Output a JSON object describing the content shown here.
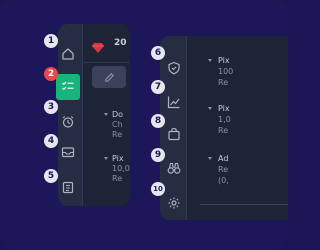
{
  "header": {
    "gem_value": "20"
  },
  "badges": [
    "1",
    "2",
    "3",
    "4",
    "5",
    "6",
    "7",
    "8",
    "9",
    "10"
  ],
  "left_list": [
    {
      "lines": [
        "Do",
        "Ch",
        "Re"
      ]
    },
    {
      "lines": [
        "Pix",
        "10,0",
        "Re"
      ]
    }
  ],
  "right_list": [
    {
      "lines": [
        "Pix",
        "100",
        "Re"
      ]
    },
    {
      "lines": [
        "Pix",
        "1,0",
        "Re"
      ]
    },
    {
      "lines": [
        "Ad",
        "Re",
        "(0,"
      ]
    }
  ],
  "icons": {
    "left_rail": [
      "home-icon",
      "checklist-icon",
      "alarm-icon",
      "inbox-icon",
      "clipboard-icon"
    ],
    "right_rail": [
      "shield-icon",
      "chart-icon",
      "shopping-bag-icon",
      "binoculars-icon",
      "gear-icon"
    ]
  },
  "colors": {
    "background": "#1b1758",
    "panel": "#1e2436",
    "accent_green": "#19b47a",
    "badge_red": "#e84848",
    "gem_red": "#d9363e"
  }
}
